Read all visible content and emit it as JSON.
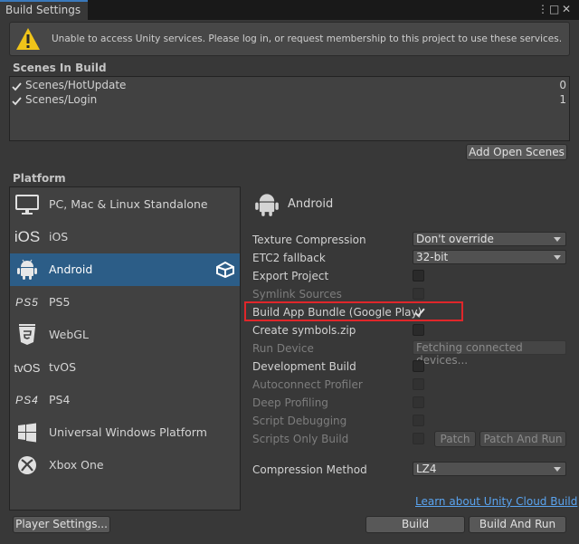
{
  "window": {
    "tab_title": "Build Settings",
    "menu_glyph": "⋮",
    "maximize_glyph": "□",
    "close_glyph": "✕"
  },
  "warning": {
    "icon": "warning-triangle-icon",
    "text": "Unable to access Unity services. Please log in, or request membership to this project to use these services."
  },
  "scenes": {
    "header": "Scenes In Build",
    "items": [
      {
        "name": "Scenes/HotUpdate",
        "index": "0",
        "checked": true
      },
      {
        "name": "Scenes/Login",
        "index": "1",
        "checked": true
      }
    ],
    "add_open_scenes": "Add Open Scenes"
  },
  "platform": {
    "header": "Platform",
    "items": [
      {
        "label": "PC, Mac & Linux Standalone",
        "icon": "monitor-icon"
      },
      {
        "label": "iOS",
        "icon": "ios-icon",
        "icon_text": "iOS"
      },
      {
        "label": "Android",
        "icon": "android-icon",
        "selected": true
      },
      {
        "label": "PS5",
        "icon": "ps5-icon",
        "icon_text": "PS5"
      },
      {
        "label": "WebGL",
        "icon": "html5-icon"
      },
      {
        "label": "tvOS",
        "icon": "tvos-icon",
        "icon_text": "tvOS"
      },
      {
        "label": "PS4",
        "icon": "ps4-icon",
        "icon_text": "PS4"
      },
      {
        "label": "Universal Windows Platform",
        "icon": "windows-icon"
      },
      {
        "label": "Xbox One",
        "icon": "xbox-icon"
      }
    ]
  },
  "settings": {
    "title": "Android",
    "texture_compression": {
      "label": "Texture Compression",
      "value": "Don't override"
    },
    "etc2_fallback": {
      "label": "ETC2 fallback",
      "value": "32-bit"
    },
    "export_project": "Export Project",
    "symlink_sources": "Symlink Sources",
    "build_app_bundle": "Build App Bundle (Google Play)",
    "create_symbols": "Create symbols.zip",
    "run_device": {
      "label": "Run Device",
      "value": "Fetching connected devices..."
    },
    "development_build": "Development Build",
    "autoconnect_profiler": "Autoconnect Profiler",
    "deep_profiling": "Deep Profiling",
    "script_debugging": "Script Debugging",
    "scripts_only_build": "Scripts Only Build",
    "patch": "Patch",
    "patch_and_run": "Patch And Run",
    "compression_method": {
      "label": "Compression Method",
      "value": "LZ4"
    },
    "cloud_build_link": "Learn about Unity Cloud Build"
  },
  "footer": {
    "player_settings": "Player Settings...",
    "build": "Build",
    "build_and_run": "Build And Run"
  },
  "colors": {
    "selected_platform": "#2c5d87",
    "link": "#5aa4f0",
    "highlight": "#e0262a",
    "warning_icon": "#f0c419"
  }
}
